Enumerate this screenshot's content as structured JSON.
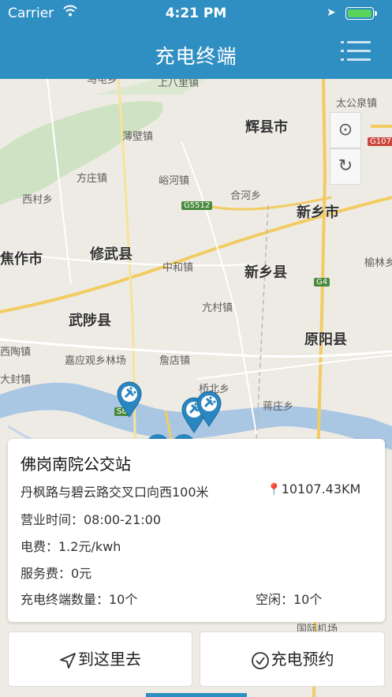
{
  "status_bar": {
    "carrier": "Carrier",
    "time": "4:21 PM"
  },
  "nav": {
    "title": "充电终端",
    "menu_icon": "list-menu-icon"
  },
  "map": {
    "cities": [
      "辉县市",
      "新乡市",
      "焦作市",
      "修武县",
      "新乡县",
      "武陟县",
      "原阳县"
    ],
    "places": [
      "马屯乡",
      "上八里镇",
      "太公泉镇",
      "薄壁镇",
      "方庄镇",
      "峪河镇",
      "合河乡",
      "西村乡",
      "中和镇",
      "榆林乡",
      "亢村镇",
      "西陶镇",
      "嘉应观乡林场",
      "詹店镇",
      "大封镇",
      "桥北乡",
      "蒋庄乡",
      "国际机场"
    ],
    "roads": [
      "G107",
      "G5512",
      "G4",
      "S8"
    ],
    "controls": [
      "locate-icon",
      "refresh-icon"
    ]
  },
  "station": {
    "name": "佛岗南院公交站",
    "address": "丹枫路与碧云路交叉口向西100米",
    "distance": "10107.43KM",
    "hours": "营业时间：08:00-21:00",
    "fee": "电费：1.2元/kwh",
    "service_fee": "服务费：0元",
    "terminal_count": "充电终端数量：10个",
    "idle": "空闲：10个"
  },
  "actions": {
    "go": "到这里去",
    "book": "充电预约"
  },
  "colors": {
    "brand": "#2f8fc2",
    "pin": "#2a86c0",
    "distance_pin": "#e0406a"
  }
}
